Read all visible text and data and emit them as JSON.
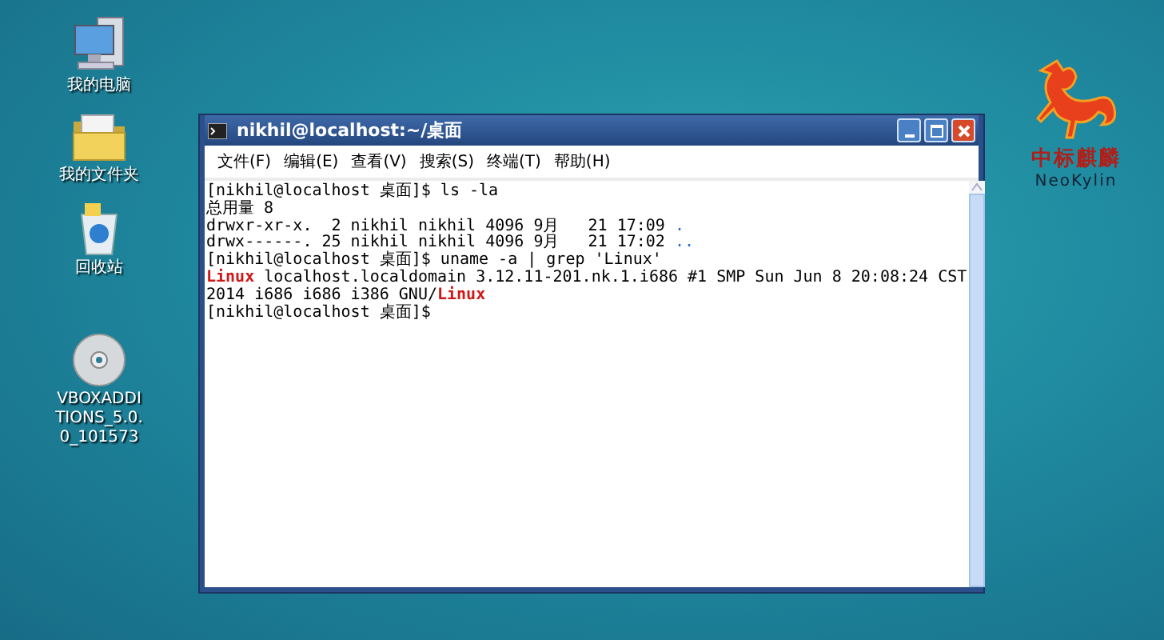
{
  "desktop_icons": [
    {
      "label": "我的电脑",
      "kind": "computer"
    },
    {
      "label": "我的文件夹",
      "kind": "folder"
    },
    {
      "label": "回收站",
      "kind": "trash"
    },
    {
      "label": "VBOXADDITIONS_5.0.0_101573",
      "kind": "disc"
    }
  ],
  "logo": {
    "title": "中标麒麟",
    "subtitle": "NeoKylin"
  },
  "window": {
    "title": "nikhil@localhost:~/桌面",
    "menu": [
      "文件(F)",
      "编辑(E)",
      "查看(V)",
      "搜索(S)",
      "终端(T)",
      "帮助(H)"
    ],
    "terminal_lines": [
      [
        {
          "text": "[nikhil@localhost 桌面]$ ls -la",
          "kind": "plain"
        }
      ],
      [
        {
          "text": "总用量 8",
          "kind": "plain"
        }
      ],
      [
        {
          "text": "drwxr-xr-x.  2 nikhil nikhil 4096 9月   21 17:09 ",
          "kind": "plain"
        },
        {
          "text": ".",
          "kind": "dir"
        }
      ],
      [
        {
          "text": "drwx------. 25 nikhil nikhil 4096 9月   21 17:02 ",
          "kind": "plain"
        },
        {
          "text": "..",
          "kind": "dir"
        }
      ],
      [
        {
          "text": "[nikhil@localhost 桌面]$ uname -a | grep 'Linux'",
          "kind": "plain"
        }
      ],
      [
        {
          "text": "Linux",
          "kind": "match"
        },
        {
          "text": " localhost.localdomain 3.12.11-201.nk.1.i686 #1 SMP Sun Jun 8 20:08:24 CST",
          "kind": "plain"
        }
      ],
      [
        {
          "text": "2014 i686 i686 i386 GNU/",
          "kind": "plain"
        },
        {
          "text": "Linux",
          "kind": "match"
        }
      ],
      [
        {
          "text": "[nikhil@localhost 桌面]$",
          "kind": "plain"
        }
      ]
    ]
  }
}
